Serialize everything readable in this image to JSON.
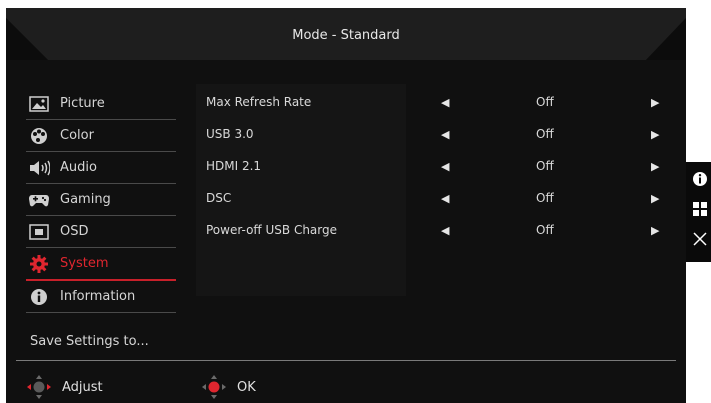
{
  "header": {
    "title": "Mode - Standard"
  },
  "sidebar": {
    "items": [
      {
        "label": "Picture",
        "icon": "picture-icon",
        "active": false
      },
      {
        "label": "Color",
        "icon": "palette-icon",
        "active": false
      },
      {
        "label": "Audio",
        "icon": "speaker-icon",
        "active": false
      },
      {
        "label": "Gaming",
        "icon": "gamepad-icon",
        "active": false
      },
      {
        "label": "OSD",
        "icon": "osd-icon",
        "active": false
      },
      {
        "label": "System",
        "icon": "gear-icon",
        "active": true
      },
      {
        "label": "Information",
        "icon": "info-icon",
        "active": false
      }
    ],
    "save_label": "Save Settings to..."
  },
  "settings": {
    "rows": [
      {
        "label": "Max Refresh Rate",
        "value": "Off"
      },
      {
        "label": "USB 3.0",
        "value": "Off"
      },
      {
        "label": "HDMI 2.1",
        "value": "Off"
      },
      {
        "label": "DSC",
        "value": "Off"
      },
      {
        "label": "Power-off USB Charge",
        "value": "Off"
      }
    ]
  },
  "footer": {
    "adjust_label": "Adjust",
    "ok_label": "OK"
  },
  "colors": {
    "accent": "#e0262f",
    "background": "#101010",
    "text": "#d9d9d9"
  }
}
